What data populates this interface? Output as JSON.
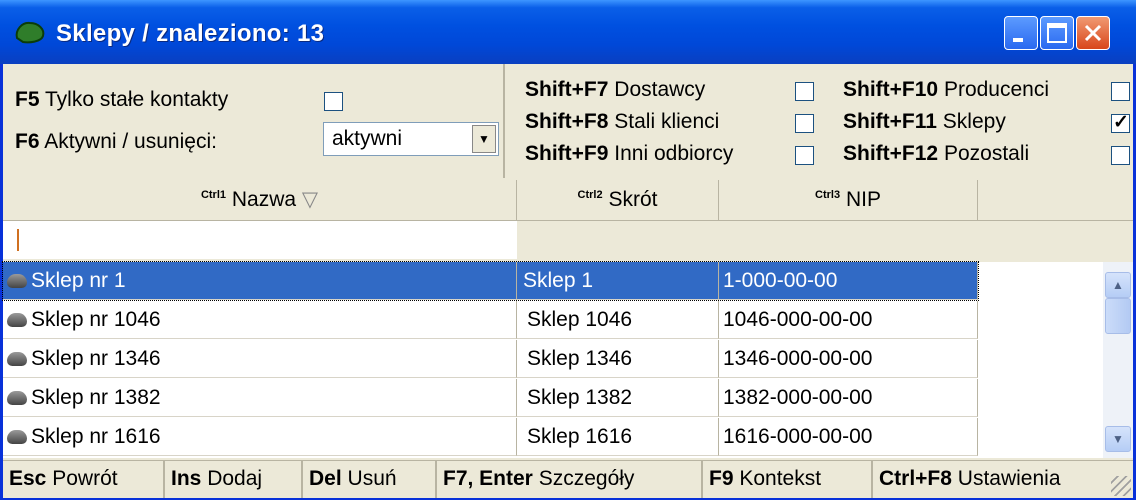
{
  "window": {
    "title": "Sklepy / znaleziono: 13",
    "app_icon": "green-blob-icon",
    "buttons": {
      "minimize": "minimize-icon",
      "maximize": "maximize-icon",
      "close": "close-icon"
    }
  },
  "filters": {
    "left": [
      {
        "key": "F5",
        "label": "Tylko stałe kontakty",
        "checked": false
      },
      {
        "key": "F6",
        "label": "Aktywni / usunięci:",
        "select_value": "aktywni"
      }
    ],
    "col1": [
      {
        "key": "Shift+F7",
        "label": "Dostawcy",
        "checked": false
      },
      {
        "key": "Shift+F8",
        "label": "Stali klienci",
        "checked": false
      },
      {
        "key": "Shift+F9",
        "label": "Inni odbiorcy",
        "checked": false
      }
    ],
    "col2": [
      {
        "key": "Shift+F10",
        "label": "Producenci",
        "checked": false
      },
      {
        "key": "Shift+F11",
        "label": "Sklepy",
        "checked": true
      },
      {
        "key": "Shift+F12",
        "label": "Pozostali",
        "checked": false
      }
    ]
  },
  "columns": [
    {
      "ctrl": "Ctrl",
      "num": "1",
      "label": "Nazwa",
      "sort": "▽"
    },
    {
      "ctrl": "Ctrl",
      "num": "2",
      "label": "Skrót"
    },
    {
      "ctrl": "Ctrl",
      "num": "3",
      "label": "NIP"
    }
  ],
  "rows": [
    {
      "name": "Sklep nr 1",
      "short": "Sklep 1",
      "nip": "1-000-00-00"
    },
    {
      "name": "Sklep nr 1046",
      "short": "Sklep 1046",
      "nip": "1046-000-00-00"
    },
    {
      "name": "Sklep nr 1346",
      "short": "Sklep 1346",
      "nip": "1346-000-00-00"
    },
    {
      "name": "Sklep nr 1382",
      "short": "Sklep 1382",
      "nip": "1382-000-00-00"
    },
    {
      "name": "Sklep nr 1616",
      "short": "Sklep 1616",
      "nip": "1616-000-00-00"
    }
  ],
  "selected_row": 0,
  "statusbar": [
    {
      "key": "Esc",
      "label": "Powrót"
    },
    {
      "key": "Ins",
      "label": "Dodaj"
    },
    {
      "key": "Del",
      "label": "Usuń"
    },
    {
      "key": "F7, Enter",
      "label": "Szczegóły"
    },
    {
      "key": "F9",
      "label": "Kontekst"
    },
    {
      "key": "Ctrl+F8",
      "label": "Ustawienia"
    }
  ],
  "scrollbar": {
    "up": "scroll-up-icon",
    "down": "scroll-down-icon"
  }
}
